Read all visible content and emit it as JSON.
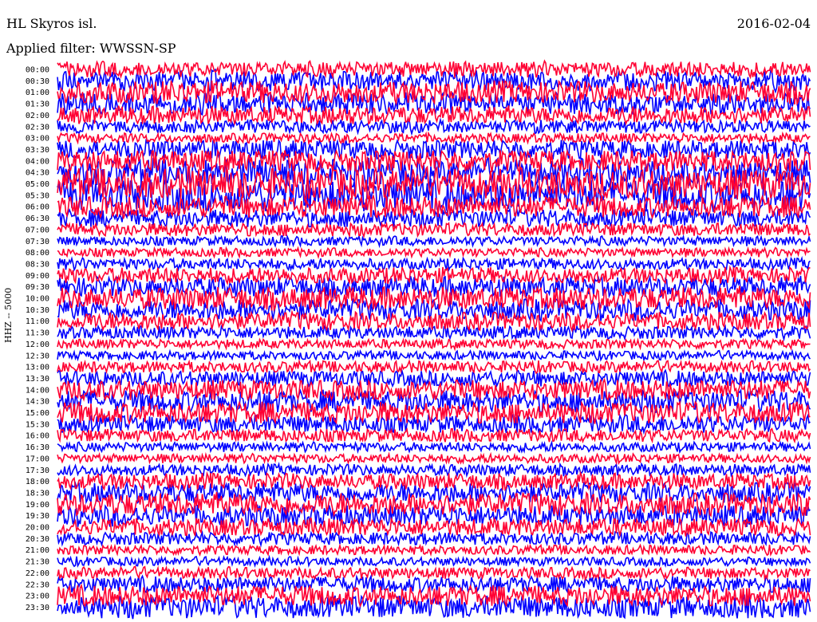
{
  "header": {
    "station": "HL Skyros isl.",
    "date": "2016-02-04",
    "filter": "Applied filter: WWSSN-SP"
  },
  "colors": {
    "trace_a": "#ff0033",
    "trace_b": "#0000ff",
    "background": "#ffffff"
  },
  "chart_data": {
    "type": "line",
    "ylabel": "HHZ -- 5000",
    "rows": [
      "00:00",
      "00:30",
      "01:00",
      "01:30",
      "02:00",
      "02:30",
      "03:00",
      "03:30",
      "04:00",
      "04:30",
      "05:00",
      "05:30",
      "06:00",
      "06:30",
      "07:00",
      "07:30",
      "08:00",
      "08:30",
      "09:00",
      "09:30",
      "10:00",
      "10:30",
      "11:00",
      "11:30",
      "12:00",
      "12:30",
      "13:00",
      "13:30",
      "14:00",
      "14:30",
      "15:00",
      "15:30",
      "16:00",
      "16:30",
      "17:00",
      "17:30",
      "18:00",
      "18:30",
      "19:00",
      "19:30",
      "20:00",
      "20:30",
      "21:00",
      "21:30",
      "22:00",
      "22:30",
      "23:00",
      "23:30"
    ],
    "series": [
      {
        "color": "#ff0033",
        "rows": "even"
      },
      {
        "color": "#0000ff",
        "rows": "odd"
      }
    ],
    "row_interval_minutes": 30
  }
}
